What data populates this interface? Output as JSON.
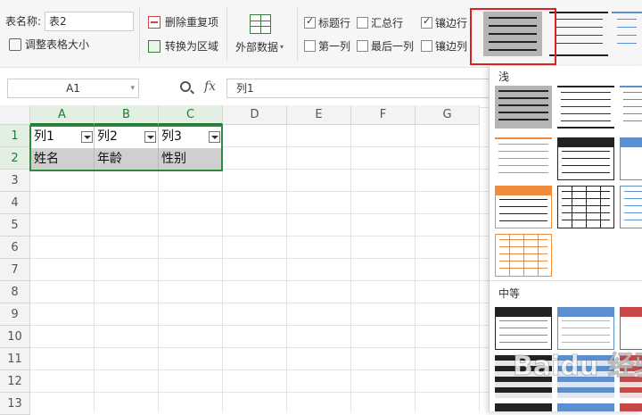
{
  "ribbon": {
    "table_name_label": "表名称:",
    "table_name_value": "表2",
    "resize_label": "调整表格大小",
    "remove_duplicates_label": "删除重复项",
    "convert_range_label": "转换为区域",
    "external_data_label": "外部数据",
    "options": [
      {
        "label": "标题行",
        "checked": true
      },
      {
        "label": "汇总行",
        "checked": false
      },
      {
        "label": "镶边行",
        "checked": true
      },
      {
        "label": "第一列",
        "checked": false
      },
      {
        "label": "最后一列",
        "checked": false
      },
      {
        "label": "镶边列",
        "checked": false
      }
    ]
  },
  "formula_bar": {
    "cell_ref": "A1",
    "fx_label": "fx",
    "formula_value": "列1"
  },
  "sheet": {
    "columns": [
      "A",
      "B",
      "C",
      "D",
      "E",
      "F",
      "G"
    ],
    "rows": [
      "1",
      "2",
      "3",
      "4",
      "5",
      "6",
      "7",
      "8",
      "9",
      "10",
      "11",
      "12",
      "13"
    ],
    "header_row": [
      "列1",
      "列2",
      "列3"
    ],
    "data_row": [
      "姓名",
      "年龄",
      "性别"
    ]
  },
  "gallery": {
    "section_light": "浅",
    "section_medium": "中等"
  },
  "watermark": "Baidu 经验",
  "colors": {
    "accent_green": "#1e7b36",
    "table_border": "#2e8b3e",
    "highlight_red": "#e02020",
    "selected_style_bg": "#b5b5b5"
  }
}
